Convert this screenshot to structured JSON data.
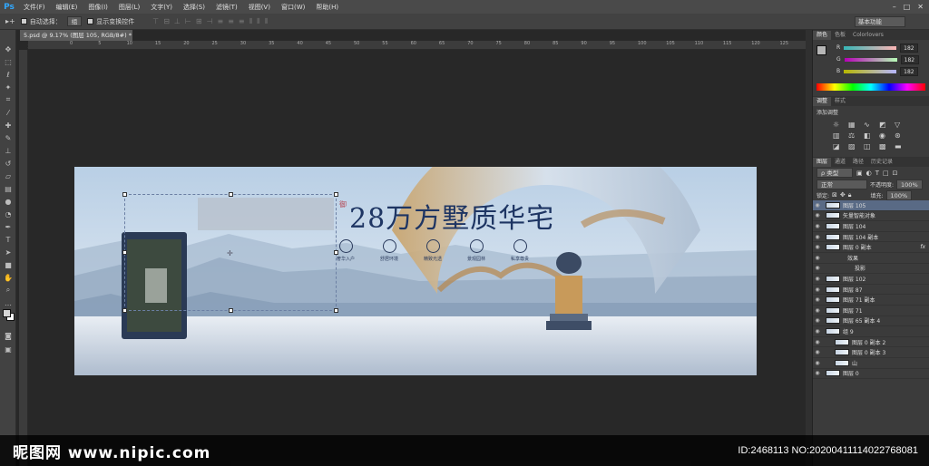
{
  "app": {
    "logo": "Ps"
  },
  "menu": [
    "文件(F)",
    "编辑(E)",
    "图像(I)",
    "图层(L)",
    "文字(Y)",
    "选择(S)",
    "滤镜(T)",
    "视图(V)",
    "窗口(W)",
    "帮助(H)"
  ],
  "options": {
    "auto_select_label": "自动选择：",
    "auto_select_value": "组",
    "show_transform_label": "显示变换控件",
    "workspace": "基本功能"
  },
  "document": {
    "tab_title": "5.psd @ 9.17% (图层 105, RGB/8#) *"
  },
  "ruler_top": [
    "0",
    "5",
    "10",
    "15",
    "20",
    "25",
    "30",
    "35",
    "40",
    "45",
    "50",
    "55",
    "60",
    "65",
    "70",
    "75",
    "80",
    "85",
    "90",
    "95",
    "100",
    "105",
    "110",
    "115",
    "120",
    "125",
    "130",
    "135"
  ],
  "banner": {
    "headline": "28万方墅质华宅",
    "seal": "御",
    "features": [
      "奢华入户",
      "舒居环境",
      "精致光透",
      "景观园林",
      "私享尊贵"
    ]
  },
  "panels": {
    "color_tabs": [
      "颜色",
      "色板",
      "Colorlovers"
    ],
    "color": {
      "channels": [
        {
          "label": "R",
          "value": "182"
        },
        {
          "label": "G",
          "value": "182"
        },
        {
          "label": "B",
          "value": "182"
        }
      ]
    },
    "adjust_tabs": [
      "调整",
      "样式"
    ],
    "adjust_title": "添加调整",
    "layer_tabs": [
      "图层",
      "通道",
      "路径",
      "历史记录"
    ],
    "layer_kind": "ρ 类型",
    "blend_mode": "正常",
    "opacity_label": "不透明度:",
    "opacity_value": "100%",
    "lock_label": "锁定:",
    "fill_label": "填充:",
    "fill_value": "100%",
    "layers": [
      {
        "name": "图层 105",
        "selected": true
      },
      {
        "name": "矢量智能对象"
      },
      {
        "name": "图层 104"
      },
      {
        "name": "图层 104 副本"
      },
      {
        "name": "图层 0 副本",
        "fx": "fx"
      },
      {
        "name": "效果"
      },
      {
        "name": "投影"
      },
      {
        "name": "图层 102"
      },
      {
        "name": "图层 87"
      },
      {
        "name": "图层 71 副本"
      },
      {
        "name": "图层 71"
      },
      {
        "name": "图层 65 副本 4"
      },
      {
        "name": "组 9"
      },
      {
        "name": "图层 0 副本 2"
      },
      {
        "name": "图层 0 副本 3"
      },
      {
        "name": "山"
      },
      {
        "name": "图层 0"
      }
    ]
  },
  "watermark": {
    "site": "昵图网 www.nipic.com",
    "id_text": "ID:2468113 NO:20200411114022768081"
  }
}
